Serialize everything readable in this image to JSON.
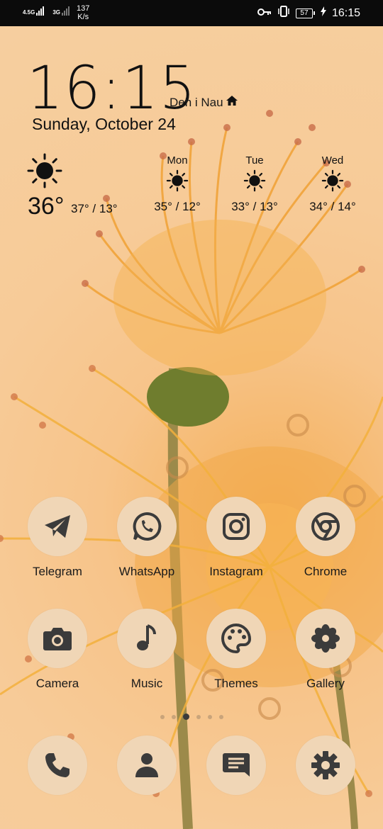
{
  "status_bar": {
    "network_1": "4.5G",
    "network_2": "3G",
    "speed_value": "137",
    "speed_unit": "K/s",
    "battery": "57",
    "time": "16:15",
    "icons": [
      "key-icon",
      "vibrate-icon",
      "battery-icon",
      "charging-icon"
    ]
  },
  "clock_widget": {
    "time": "16:15",
    "location": "Deh i Nau",
    "date": "Sunday, October 24"
  },
  "weather": {
    "current_temp": "36°",
    "today_range": "37° / 13°",
    "forecast": [
      {
        "day": "Mon",
        "range": "35° / 12°",
        "icon": "sun-icon"
      },
      {
        "day": "Tue",
        "range": "33° / 13°",
        "icon": "sun-icon"
      },
      {
        "day": "Wed",
        "range": "34° / 14°",
        "icon": "sun-icon"
      }
    ]
  },
  "apps": [
    {
      "label": "Telegram",
      "icon": "telegram-icon"
    },
    {
      "label": "WhatsApp",
      "icon": "whatsapp-icon"
    },
    {
      "label": "Instagram",
      "icon": "instagram-icon"
    },
    {
      "label": "Chrome",
      "icon": "chrome-icon"
    },
    {
      "label": "Camera",
      "icon": "camera-icon"
    },
    {
      "label": "Music",
      "icon": "music-icon"
    },
    {
      "label": "Themes",
      "icon": "palette-icon"
    },
    {
      "label": "Gallery",
      "icon": "flower-icon"
    }
  ],
  "page_indicator": {
    "total": 6,
    "active": 3
  },
  "dock": [
    {
      "icon": "phone-icon"
    },
    {
      "icon": "contacts-icon"
    },
    {
      "icon": "messages-icon"
    },
    {
      "icon": "settings-gear-icon"
    }
  ],
  "colors": {
    "wallpaper": "#f7c78f",
    "icon_bg": "#f0d6b6",
    "icon_glyph": "#3b3b3b"
  }
}
